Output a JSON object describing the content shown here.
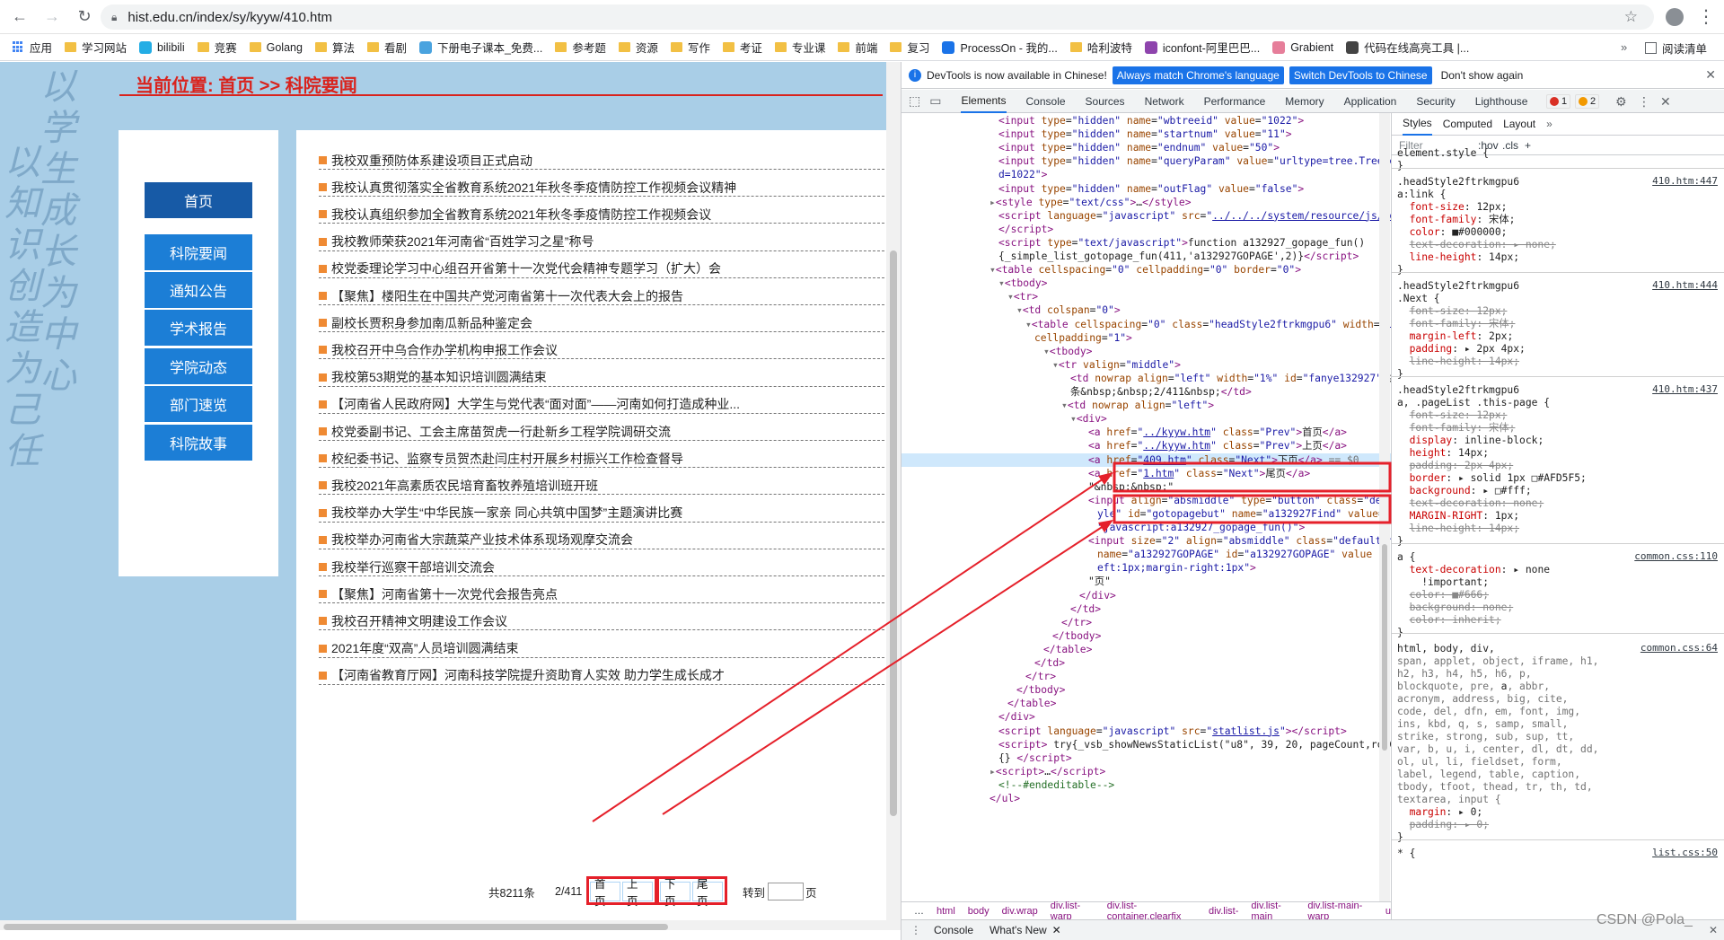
{
  "browser": {
    "url": "hist.edu.cn/index/sy/kyyw/410.htm",
    "bookmarks": [
      "应用",
      "学习网站",
      "bilibili",
      "竞赛",
      "Golang",
      "算法",
      "看剧",
      "下册电子课本_免费...",
      "参考题",
      "资源",
      "写作",
      "考证",
      "专业课",
      "前端",
      "复习",
      "ProcessOn - 我的...",
      "哈利波特",
      "iconfont-阿里巴巴...",
      "Grabient",
      "代码在线高亮工具 |..."
    ],
    "reading_list": "阅读清单",
    "more": "»"
  },
  "site": {
    "location": "当前位置: 首页 >> 科院要闻",
    "calligraphy_left": "以知识创造为己任",
    "calligraphy_right": "以学生成长为中心",
    "sidebar": [
      "首页",
      "科院要闻",
      "通知公告",
      "学术报告",
      "学院动态",
      "部门速览",
      "科院故事"
    ],
    "news": [
      "我校双重预防体系建设项目正式启动",
      "我校认真贯彻落实全省教育系统2021年秋冬季疫情防控工作视频会议精神",
      "我校认真组织参加全省教育系统2021年秋冬季疫情防控工作视频会议",
      "我校教师荣获2021年河南省“百姓学习之星”称号",
      "校党委理论学习中心组召开省第十一次党代会精神专题学习（扩大）会",
      "【聚焦】楼阳生在中国共产党河南省第十一次代表大会上的报告",
      "副校长贾积身参加南瓜新品种鉴定会",
      "我校召开中乌合作办学机构申报工作会议",
      "我校第53期党的基本知识培训圆满结束",
      "【河南省人民政府网】大学生与党代表“面对面”——河南如何打造成种业...",
      "校党委副书记、工会主席苗贺虎一行赴新乡工程学院调研交流",
      "校纪委书记、监察专员贺杰赴闫庄村开展乡村振兴工作检查督导",
      "我校2021年高素质农民培育畜牧养殖培训班开班",
      "我校举办大学生“中华民族一家亲 同心共筑中国梦”主题演讲比赛",
      "我校举办河南省大宗蔬菜产业技术体系现场观摩交流会",
      "我校举行巡察干部培训交流会",
      "【聚焦】河南省第十一次党代会报告亮点",
      "我校召开精神文明建设工作会议",
      "2021年度“双高”人员培训圆满结束",
      "【河南省教育厅网】河南科技学院提升资助育人实效 助力学生成长成才"
    ],
    "pager": {
      "total": "共8211条",
      "page": "2/411",
      "first": "首页",
      "prev": "上页",
      "next": "下页",
      "last": "尾页",
      "goto": "转到",
      "unit": "页"
    }
  },
  "devtools": {
    "info": "DevTools is now available in Chinese!",
    "btn_match": "Always match Chrome's language",
    "btn_switch": "Switch DevTools to Chinese",
    "dont_show": "Don't show again",
    "tabs": [
      "Elements",
      "Console",
      "Sources",
      "Network",
      "Performance",
      "Memory",
      "Application",
      "Security",
      "Lighthouse"
    ],
    "errors": "1",
    "warnings": "2",
    "breadcrumbs": [
      "html",
      "body",
      "div.wrap",
      "div.list-warp",
      "div.list-container.clearfix",
      "div.list-",
      "div.list-main",
      "div.list-main-warp",
      "u"
    ],
    "drawer_tabs": [
      "Console",
      "What's New"
    ],
    "styles_tabs": [
      "Styles",
      "Computed",
      "Layout"
    ],
    "filter_placeholder": "Filter",
    "filter_hov": ":hov",
    "filter_cls": ".cls"
  },
  "watermark": "CSDN @Pola_"
}
